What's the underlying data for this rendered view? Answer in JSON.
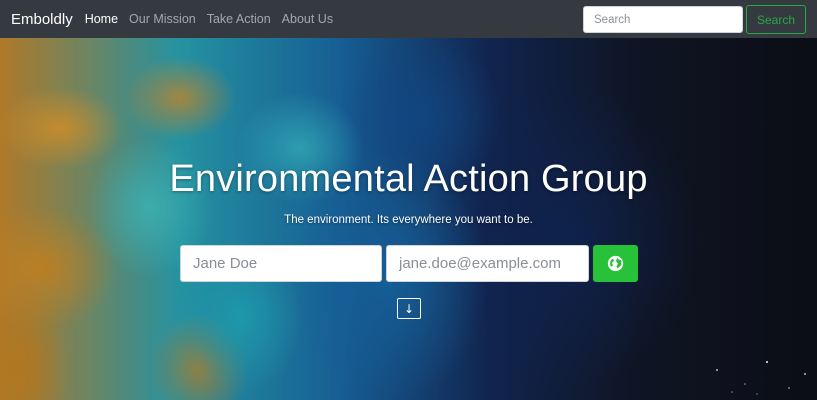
{
  "navbar": {
    "brand": "Emboldly",
    "links": [
      {
        "label": "Home",
        "active": true
      },
      {
        "label": "Our Mission",
        "active": false
      },
      {
        "label": "Take Action",
        "active": false
      },
      {
        "label": "About Us",
        "active": false
      }
    ],
    "search_placeholder": "Search",
    "search_button": "Search"
  },
  "hero": {
    "title": "Environmental Action Group",
    "subtitle": "The environment. Its everywhere you want to be.",
    "name_placeholder": "Jane Doe",
    "email_placeholder": "jane.doe@example.com",
    "submit_icon": "globe-icon",
    "scroll_icon": "arrow-down-icon",
    "scroll_glyph": "↓"
  },
  "colors": {
    "navbar_bg": "#343a40",
    "accent_green": "#28a745",
    "submit_green": "#28c13a"
  }
}
